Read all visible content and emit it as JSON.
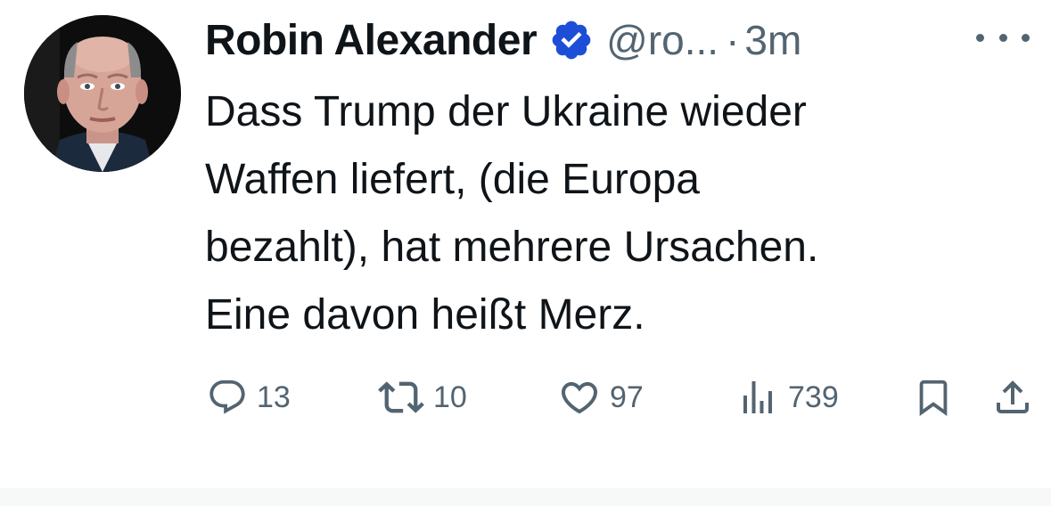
{
  "tweet": {
    "author_name": "Robin Alexander",
    "handle": "@ro...",
    "separator": "·",
    "time": "3m",
    "text_lines": [
      "Dass Trump der Ukraine wieder",
      "Waffen liefert, (die Europa",
      "bezahlt), hat mehrere Ursachen.",
      "Eine davon heißt Merz."
    ],
    "verified_color": "#1d4ed8",
    "text_color": "#0f1419",
    "muted_color": "#536471"
  },
  "actions": {
    "replies": "13",
    "reposts": "10",
    "likes": "97",
    "views": "739",
    "icons": [
      "reply-icon",
      "repost-icon",
      "like-icon",
      "views-icon",
      "bookmark-icon",
      "share-icon"
    ]
  }
}
